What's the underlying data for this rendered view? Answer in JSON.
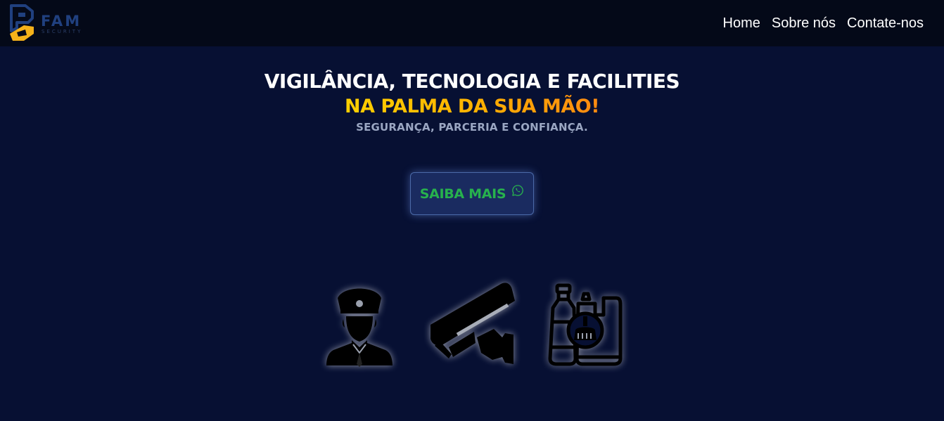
{
  "header": {
    "logo": {
      "name": "FAM",
      "subtitle": "SECURITY",
      "colors": {
        "primary": "#20407f",
        "accent": "#f5b21a"
      }
    },
    "nav": [
      {
        "label": "Home"
      },
      {
        "label": "Sobre nós"
      },
      {
        "label": "Contate-nos"
      }
    ]
  },
  "hero": {
    "headline_line1": "VIGILÂNCIA, TECNOLOGIA E FACILITIES",
    "headline_line2": "NA PALMA DA SUA MÃO!",
    "tagline": "SEGURANÇA, PARCERIA E CONFIANÇA.",
    "cta": {
      "label": "SAIBA MAIS",
      "icon": "whatsapp-icon",
      "color": "#27b24d"
    }
  },
  "services": [
    {
      "icon": "security-guard-icon"
    },
    {
      "icon": "security-camera-icon"
    },
    {
      "icon": "cleaning-supplies-icon"
    }
  ],
  "colors": {
    "background": "#071033",
    "navbar": "#040918",
    "headline_gradient": [
      "#ffd000",
      "#ff8a10"
    ]
  }
}
